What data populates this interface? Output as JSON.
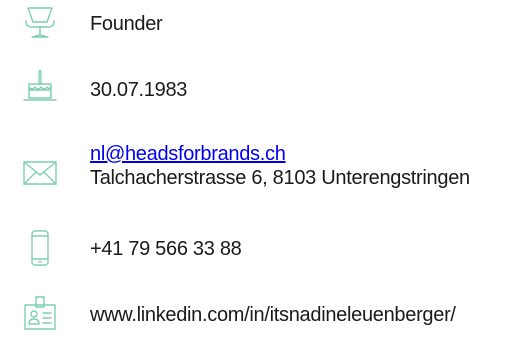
{
  "accent_color": "#7fcfae",
  "rows": [
    {
      "icon": "chair-icon",
      "label": "Founder"
    },
    {
      "icon": "birthday-cake-icon",
      "label": "30.07.1983"
    },
    {
      "icon": "envelope-icon",
      "email": "nl@headsforbrands.ch",
      "address": "Talchacherstrasse 6, 8103 Unterengstringen"
    },
    {
      "icon": "smartphone-icon",
      "label": "+41 79 566 33 88"
    },
    {
      "icon": "linkedin-profile-icon",
      "label": "www.linkedin.com/in/itsnadineleuenberger/"
    }
  ]
}
